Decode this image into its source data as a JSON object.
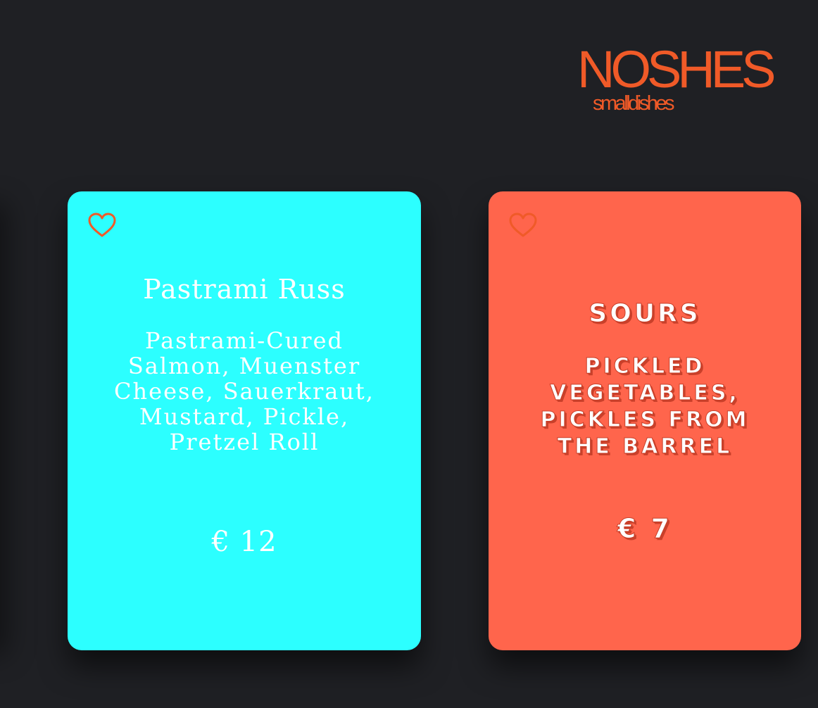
{
  "brand": {
    "name": "NOSHES",
    "tagline": "smalldishes",
    "color": "#f05a28"
  },
  "cards": [
    {
      "title": "Pastrami Russ",
      "description": "Pastrami-Cured Salmon, Muenster Cheese, Sauerkraut, Mustard, Pickle, Pretzel Roll",
      "price": "€ 12",
      "background": "#2cffff",
      "icon": "heart-outline-icon"
    },
    {
      "title": "Sours",
      "description": "Pickled Vegetables, Pickles from the Barrel",
      "price": "€ 7",
      "background": "#ff654c",
      "icon": "heart-outline-icon"
    }
  ],
  "colors": {
    "page_background": "#1f2024",
    "heart": "#f05a28"
  }
}
